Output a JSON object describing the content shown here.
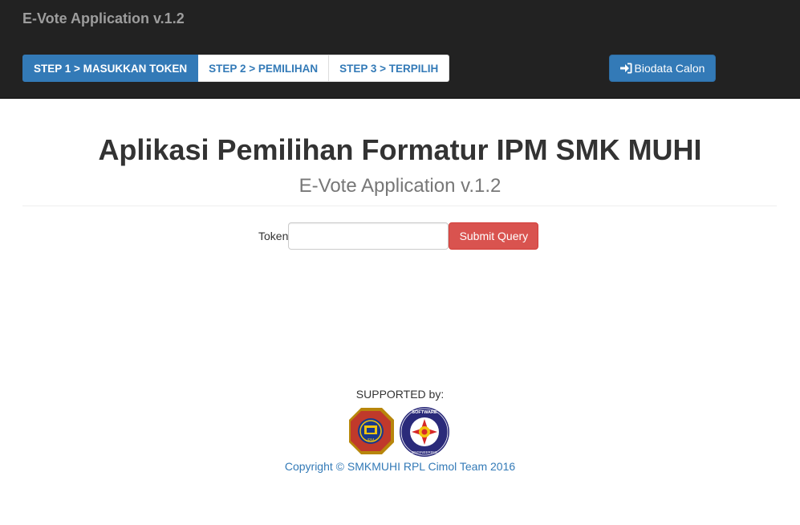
{
  "navbar": {
    "brand": "E-Vote Application v.1.2",
    "steps": [
      {
        "label": "STEP 1 > MASUKKAN TOKEN",
        "active": true
      },
      {
        "label": "STEP 2 > PEMILIHAN",
        "active": false
      },
      {
        "label": "STEP 3 > TERPILIH",
        "active": false
      }
    ],
    "biodata_button": {
      "label": "Biodata Calon",
      "icon": "sign-in-icon"
    }
  },
  "header": {
    "title": "Aplikasi Pemilihan Formatur IPM SMK MUHI",
    "subtitle": "E-Vote Application v.1.2"
  },
  "form": {
    "token_label": "Token",
    "token_value": "",
    "token_placeholder": "",
    "submit_label": "Submit Query"
  },
  "footer": {
    "supported_label": "SUPPORTED by:",
    "logos": [
      {
        "name": "ipm-logo",
        "logo_text": "IPM"
      },
      {
        "name": "software-engineering-logo",
        "logo_text": "SOFTWARE ENGINEERING"
      }
    ],
    "copyright": "Copyright © SMKMUHI RPL Cimol Team 2016"
  },
  "colors": {
    "navbar_bg": "#222222",
    "primary": "#337ab7",
    "danger": "#d9534f",
    "brand_text": "#9d9d9d"
  }
}
